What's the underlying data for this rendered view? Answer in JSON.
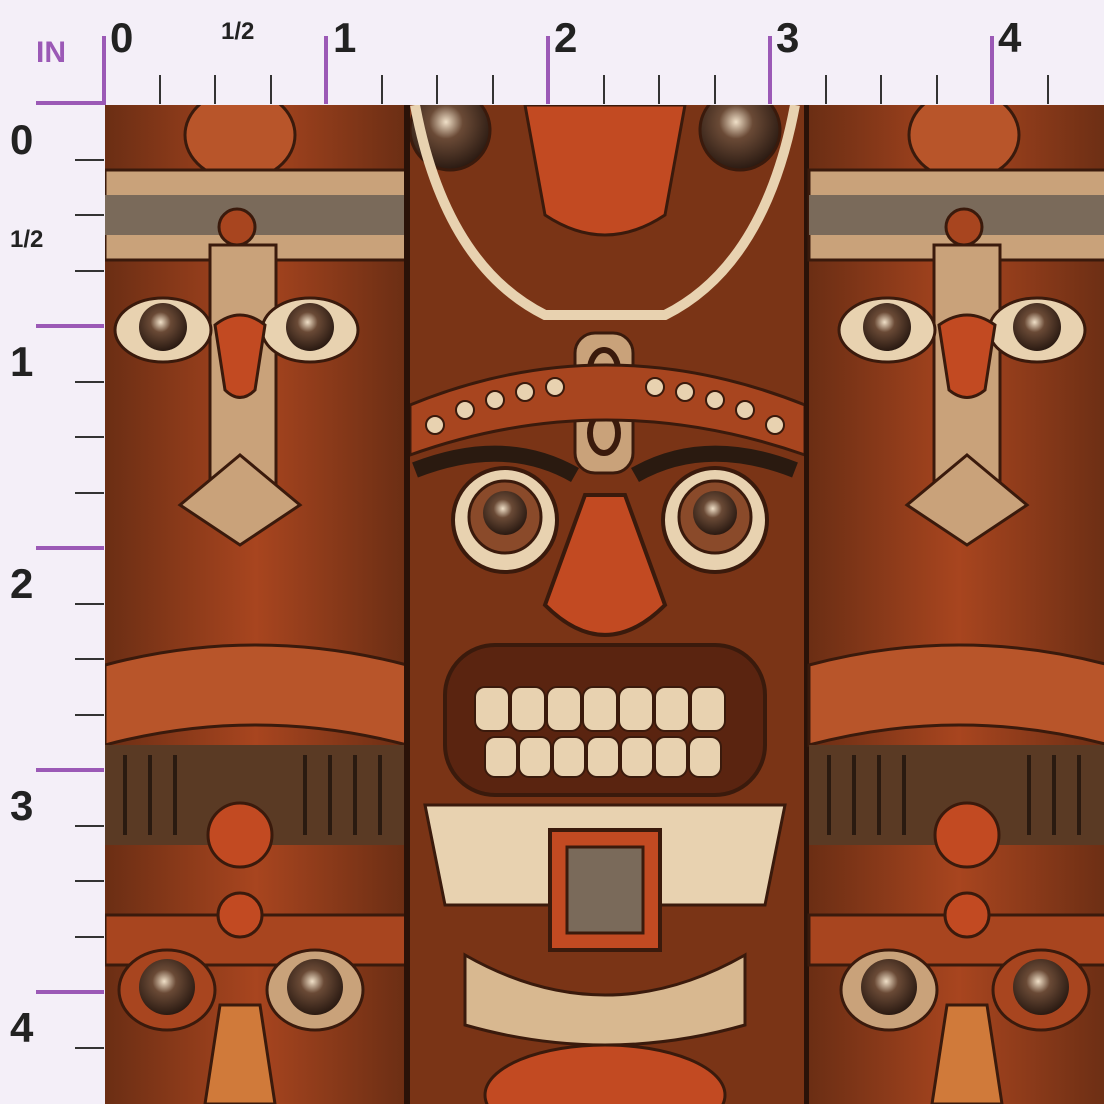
{
  "ruler": {
    "unit_label": "IN",
    "top_labels": [
      "0",
      "1/2",
      "1",
      "2",
      "3",
      "4"
    ],
    "left_labels": [
      "0",
      "1/2",
      "1",
      "2",
      "3",
      "4"
    ],
    "accent_color": "#9b59b6"
  },
  "fabric": {
    "pattern": "carved wooden tiki totem faces",
    "colors": [
      "#a8451f",
      "#c9a27a",
      "#5a2a14",
      "#e8d2b0"
    ]
  }
}
